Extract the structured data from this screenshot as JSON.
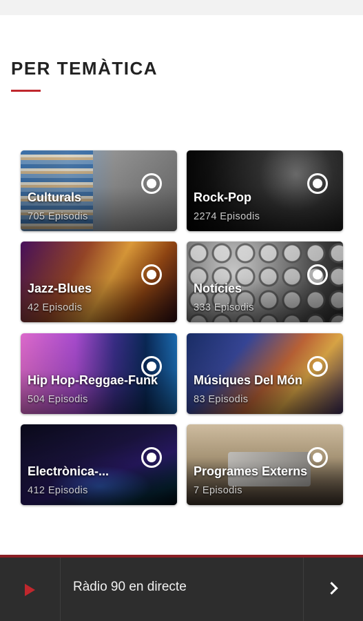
{
  "section": {
    "title": "PER TEMÀTICA",
    "accent_color": "#c0272d"
  },
  "categories": [
    {
      "name": "Culturals",
      "count": "705 Episodis"
    },
    {
      "name": "Rock-Pop",
      "count": "2274 Episodis"
    },
    {
      "name": "Jazz-Blues",
      "count": "42 Episodis"
    },
    {
      "name": "Notícies",
      "count": "333 Episodis"
    },
    {
      "name": "Hip Hop-Reggae-Funk",
      "count": "504 Episodis"
    },
    {
      "name": "Músiques Del Món",
      "count": "83 Episodis"
    },
    {
      "name": "Electrònica-...",
      "count": "412 Episodis"
    },
    {
      "name": "Programes Externs",
      "count": "7 Episodis"
    }
  ],
  "player": {
    "label": "Ràdio 90 en directe",
    "play_icon": "play-icon",
    "next_icon": "chevron-right-icon",
    "background_color": "#2d2d2d"
  }
}
